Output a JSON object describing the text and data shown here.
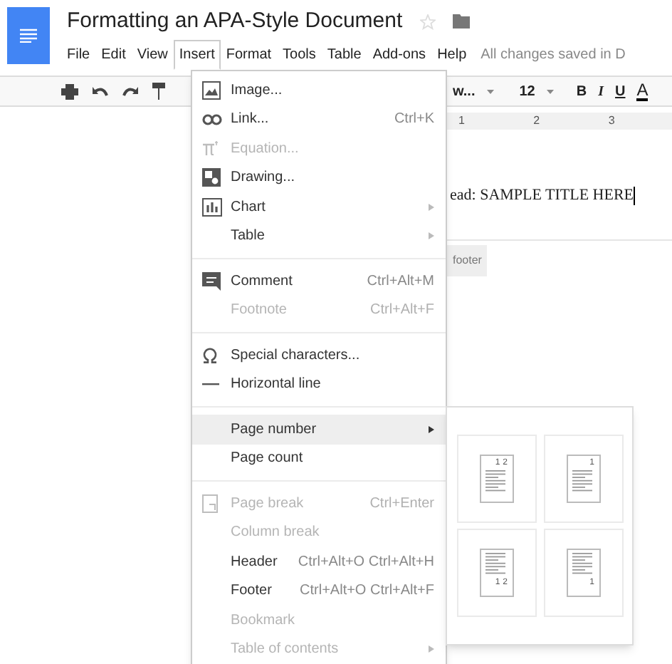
{
  "document_title": "Formatting an APA-Style Document",
  "menu_bar": [
    {
      "label": "File",
      "selected": false
    },
    {
      "label": "Edit",
      "selected": false
    },
    {
      "label": "View",
      "selected": false
    },
    {
      "label": "Insert",
      "selected": true
    },
    {
      "label": "Format",
      "selected": false
    },
    {
      "label": "Tools",
      "selected": false
    },
    {
      "label": "Table",
      "selected": false
    },
    {
      "label": "Add-ons",
      "selected": false
    },
    {
      "label": "Help",
      "selected": false
    }
  ],
  "save_status": "All changes saved in D",
  "toolbar": {
    "font_name": "w...",
    "font_size": "12",
    "bold": "B",
    "italic": "I",
    "underline": "U",
    "text_color": "A"
  },
  "ruler": [
    "1",
    "2",
    "3"
  ],
  "document_text": "ead: SAMPLE TITLE HERE",
  "footer_tab": "footer",
  "insert_menu": [
    {
      "kind": "image",
      "label": "Image...",
      "disabled": false,
      "selected": false,
      "submenu": false
    },
    {
      "kind": "link",
      "label": "Link...",
      "shortcut": "Ctrl+K",
      "disabled": false,
      "selected": false,
      "submenu": false
    },
    {
      "kind": "equation",
      "label": "Equation...",
      "disabled": true,
      "selected": false,
      "submenu": false
    },
    {
      "kind": "drawing",
      "label": "Drawing...",
      "disabled": false,
      "selected": false,
      "submenu": false
    },
    {
      "kind": "chart",
      "label": "Chart",
      "disabled": false,
      "selected": false,
      "submenu": true
    },
    {
      "kind": "plain",
      "label": "Table",
      "disabled": false,
      "selected": false,
      "submenu": true
    },
    {
      "kind": "separator"
    },
    {
      "kind": "comment",
      "label": "Comment",
      "shortcut": "Ctrl+Alt+M",
      "disabled": false,
      "selected": false,
      "submenu": false
    },
    {
      "kind": "plain",
      "label": "Footnote",
      "shortcut": "Ctrl+Alt+F",
      "disabled": true,
      "selected": false,
      "submenu": false
    },
    {
      "kind": "separator"
    },
    {
      "kind": "omega",
      "label": "Special characters...",
      "disabled": false,
      "selected": false,
      "submenu": false
    },
    {
      "kind": "line",
      "label": "Horizontal line",
      "disabled": false,
      "selected": false,
      "submenu": false
    },
    {
      "kind": "separator"
    },
    {
      "kind": "plain",
      "label": "Page number",
      "disabled": false,
      "selected": true,
      "submenu": true
    },
    {
      "kind": "plain",
      "label": "Page count",
      "disabled": false,
      "selected": false,
      "submenu": false
    },
    {
      "kind": "separator"
    },
    {
      "kind": "pagebreak",
      "label": "Page break",
      "shortcut": "Ctrl+Enter",
      "disabled": true,
      "selected": false,
      "submenu": false
    },
    {
      "kind": "plain",
      "label": "Column break",
      "disabled": true,
      "selected": false,
      "submenu": false
    },
    {
      "kind": "plain",
      "label": "Header",
      "shortcut": "Ctrl+Alt+O Ctrl+Alt+H",
      "disabled": false,
      "selected": false,
      "submenu": false
    },
    {
      "kind": "plain",
      "label": "Footer",
      "shortcut": "Ctrl+Alt+O Ctrl+Alt+F",
      "disabled": false,
      "selected": false,
      "submenu": false
    },
    {
      "kind": "plain",
      "label": "Bookmark",
      "disabled": true,
      "selected": false,
      "submenu": false
    },
    {
      "kind": "plain",
      "label": "Table of contents",
      "disabled": true,
      "selected": false,
      "submenu": true
    }
  ],
  "page_number_options": [
    {
      "kind": "top",
      "numbers": [
        "1",
        "2"
      ]
    },
    {
      "kind": "top",
      "numbers": [
        "1"
      ]
    },
    {
      "kind": "bottom",
      "numbers": [
        "1",
        "2"
      ]
    },
    {
      "kind": "bottom",
      "numbers": [
        "1"
      ]
    }
  ]
}
